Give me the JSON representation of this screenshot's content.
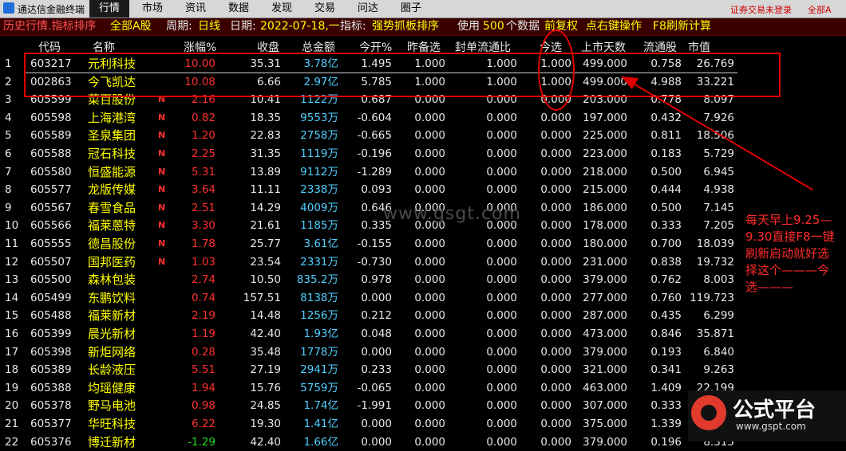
{
  "app": {
    "title": "通达信金融终端"
  },
  "menu": [
    {
      "label": "行情",
      "active": true
    },
    {
      "label": "市场",
      "active": false
    },
    {
      "label": "资讯",
      "active": false
    },
    {
      "label": "数据",
      "active": false
    },
    {
      "label": "发现",
      "active": false
    },
    {
      "label": "交易",
      "active": false
    },
    {
      "label": "问达",
      "active": false
    },
    {
      "label": "圈子",
      "active": false
    }
  ],
  "topright": {
    "login_status": "证券交易未登录",
    "account": "全部A"
  },
  "infobar": {
    "mode": "历史行情.指标排序",
    "board": "全部A股",
    "period_label": "周期:",
    "period": "日线",
    "date_label": "日期:",
    "date": "2022-07-18,一",
    "indicator_label": "指标:",
    "indicator": "强势抓板排序",
    "use_label": "使用",
    "count": "500",
    "count_suffix": "个数据",
    "adjust": "前复权",
    "right_click": "点右键操作",
    "refresh": "F8刷新计算"
  },
  "columns": [
    "代码",
    "名称",
    "涨幅%",
    "收盘",
    "总金额",
    "今开%",
    "昨备选",
    "封单流通比",
    "今选",
    "上市天数",
    "流通股",
    "市值"
  ],
  "rows": [
    {
      "idx": "1",
      "code": "603217",
      "name": "元利科技",
      "flag": "",
      "chg": "10.00",
      "chg_color": "red",
      "close": "35.31",
      "amount": "3.78亿",
      "open": "1.495",
      "open_color": "wht",
      "prev": "1.000",
      "seal": "1.000",
      "today": "1.000",
      "days": "499.000",
      "float": "0.758",
      "mcap": "26.769"
    },
    {
      "idx": "2",
      "code": "002863",
      "name": "今飞凯达",
      "flag": "",
      "chg": "10.08",
      "chg_color": "red",
      "close": "6.66",
      "amount": "2.97亿",
      "open": "5.785",
      "open_color": "wht",
      "prev": "1.000",
      "seal": "1.000",
      "today": "1.000",
      "days": "499.000",
      "float": "4.988",
      "mcap": "33.221"
    },
    {
      "idx": "3",
      "code": "605599",
      "name": "菜百股份",
      "flag": "N",
      "chg": "2.16",
      "chg_color": "red",
      "close": "10.41",
      "amount": "1122万",
      "open": "0.687",
      "open_color": "wht",
      "prev": "0.000",
      "seal": "0.000",
      "today": "0.000",
      "days": "203.000",
      "float": "0.778",
      "mcap": "8.097"
    },
    {
      "idx": "4",
      "code": "605598",
      "name": "上海港湾",
      "flag": "N",
      "chg": "0.82",
      "chg_color": "red",
      "close": "18.35",
      "amount": "9553万",
      "open": "-0.604",
      "open_color": "wht",
      "prev": "0.000",
      "seal": "0.000",
      "today": "0.000",
      "days": "197.000",
      "float": "0.432",
      "mcap": "7.926"
    },
    {
      "idx": "5",
      "code": "605589",
      "name": "圣泉集团",
      "flag": "N",
      "chg": "1.20",
      "chg_color": "red",
      "close": "22.83",
      "amount": "2758万",
      "open": "-0.665",
      "open_color": "wht",
      "prev": "0.000",
      "seal": "0.000",
      "today": "0.000",
      "days": "225.000",
      "float": "0.811",
      "mcap": "18.506"
    },
    {
      "idx": "6",
      "code": "605588",
      "name": "冠石科技",
      "flag": "N",
      "chg": "2.25",
      "chg_color": "red",
      "close": "31.35",
      "amount": "1119万",
      "open": "-0.196",
      "open_color": "wht",
      "prev": "0.000",
      "seal": "0.000",
      "today": "0.000",
      "days": "223.000",
      "float": "0.183",
      "mcap": "5.729"
    },
    {
      "idx": "7",
      "code": "605580",
      "name": "恒盛能源",
      "flag": "N",
      "chg": "5.31",
      "chg_color": "red",
      "close": "13.89",
      "amount": "9112万",
      "open": "-1.289",
      "open_color": "wht",
      "prev": "0.000",
      "seal": "0.000",
      "today": "0.000",
      "days": "218.000",
      "float": "0.500",
      "mcap": "6.945"
    },
    {
      "idx": "8",
      "code": "605577",
      "name": "龙版传媒",
      "flag": "N",
      "chg": "3.64",
      "chg_color": "red",
      "close": "11.11",
      "amount": "2338万",
      "open": "0.093",
      "open_color": "wht",
      "prev": "0.000",
      "seal": "0.000",
      "today": "0.000",
      "days": "215.000",
      "float": "0.444",
      "mcap": "4.938"
    },
    {
      "idx": "9",
      "code": "605567",
      "name": "春雪食品",
      "flag": "N",
      "chg": "2.51",
      "chg_color": "red",
      "close": "14.29",
      "amount": "4009万",
      "open": "0.646",
      "open_color": "wht",
      "prev": "0.000",
      "seal": "0.000",
      "today": "0.000",
      "days": "186.000",
      "float": "0.500",
      "mcap": "7.145"
    },
    {
      "idx": "10",
      "code": "605566",
      "name": "福莱蒽特",
      "flag": "N",
      "chg": "3.30",
      "chg_color": "red",
      "close": "21.61",
      "amount": "1185万",
      "open": "0.335",
      "open_color": "wht",
      "prev": "0.000",
      "seal": "0.000",
      "today": "0.000",
      "days": "178.000",
      "float": "0.333",
      "mcap": "7.205"
    },
    {
      "idx": "11",
      "code": "605555",
      "name": "德昌股份",
      "flag": "N",
      "chg": "1.78",
      "chg_color": "red",
      "close": "25.77",
      "amount": "3.61亿",
      "open": "-0.155",
      "open_color": "wht",
      "prev": "0.000",
      "seal": "0.000",
      "today": "0.000",
      "days": "180.000",
      "float": "0.700",
      "mcap": "18.039"
    },
    {
      "idx": "12",
      "code": "605507",
      "name": "国邦医药",
      "flag": "N",
      "chg": "1.03",
      "chg_color": "red",
      "close": "23.54",
      "amount": "2331万",
      "open": "-0.730",
      "open_color": "wht",
      "prev": "0.000",
      "seal": "0.000",
      "today": "0.000",
      "days": "231.000",
      "float": "0.838",
      "mcap": "19.732"
    },
    {
      "idx": "13",
      "code": "605500",
      "name": "森林包装",
      "flag": "",
      "chg": "2.74",
      "chg_color": "red",
      "close": "10.50",
      "amount": "835.2万",
      "open": "0.978",
      "open_color": "wht",
      "prev": "0.000",
      "seal": "0.000",
      "today": "0.000",
      "days": "379.000",
      "float": "0.762",
      "mcap": "8.003"
    },
    {
      "idx": "14",
      "code": "605499",
      "name": "东鹏饮料",
      "flag": "",
      "chg": "0.74",
      "chg_color": "red",
      "close": "157.51",
      "amount": "8138万",
      "open": "0.000",
      "open_color": "wht",
      "prev": "0.000",
      "seal": "0.000",
      "today": "0.000",
      "days": "277.000",
      "float": "0.760",
      "mcap": "119.723"
    },
    {
      "idx": "15",
      "code": "605488",
      "name": "福莱新材",
      "flag": "",
      "chg": "2.19",
      "chg_color": "red",
      "close": "14.48",
      "amount": "1256万",
      "open": "0.212",
      "open_color": "wht",
      "prev": "0.000",
      "seal": "0.000",
      "today": "0.000",
      "days": "287.000",
      "float": "0.435",
      "mcap": "6.299"
    },
    {
      "idx": "16",
      "code": "605399",
      "name": "晨光新材",
      "flag": "",
      "chg": "1.19",
      "chg_color": "red",
      "close": "42.40",
      "amount": "1.93亿",
      "open": "0.048",
      "open_color": "wht",
      "prev": "0.000",
      "seal": "0.000",
      "today": "0.000",
      "days": "473.000",
      "float": "0.846",
      "mcap": "35.871"
    },
    {
      "idx": "17",
      "code": "605398",
      "name": "新炬网络",
      "flag": "",
      "chg": "0.28",
      "chg_color": "red",
      "close": "35.48",
      "amount": "1778万",
      "open": "0.000",
      "open_color": "wht",
      "prev": "0.000",
      "seal": "0.000",
      "today": "0.000",
      "days": "379.000",
      "float": "0.193",
      "mcap": "6.840"
    },
    {
      "idx": "18",
      "code": "605389",
      "name": "长龄液压",
      "flag": "",
      "chg": "5.51",
      "chg_color": "red",
      "close": "27.19",
      "amount": "2941万",
      "open": "0.233",
      "open_color": "wht",
      "prev": "0.000",
      "seal": "0.000",
      "today": "0.000",
      "days": "321.000",
      "float": "0.341",
      "mcap": "9.263"
    },
    {
      "idx": "19",
      "code": "605388",
      "name": "均瑶健康",
      "flag": "",
      "chg": "1.94",
      "chg_color": "red",
      "close": "15.76",
      "amount": "5759万",
      "open": "-0.065",
      "open_color": "wht",
      "prev": "0.000",
      "seal": "0.000",
      "today": "0.000",
      "days": "463.000",
      "float": "1.409",
      "mcap": "22.199"
    },
    {
      "idx": "20",
      "code": "605378",
      "name": "野马电池",
      "flag": "",
      "chg": "0.98",
      "chg_color": "red",
      "close": "24.85",
      "amount": "1.74亿",
      "open": "-1.991",
      "open_color": "wht",
      "prev": "0.000",
      "seal": "0.000",
      "today": "0.000",
      "days": "307.000",
      "float": "0.333",
      "mcap": "8.290"
    },
    {
      "idx": "21",
      "code": "605377",
      "name": "华旺科技",
      "flag": "",
      "chg": "6.22",
      "chg_color": "red",
      "close": "19.30",
      "amount": "1.41亿",
      "open": "0.000",
      "open_color": "wht",
      "prev": "0.000",
      "seal": "0.000",
      "today": "0.000",
      "days": "375.000",
      "float": "1.339",
      "mcap": "25.841"
    },
    {
      "idx": "22",
      "code": "605376",
      "name": "博迁新材",
      "flag": "",
      "chg": "-1.29",
      "chg_color": "green",
      "close": "42.40",
      "amount": "1.66亿",
      "open": "0.000",
      "open_color": "wht",
      "prev": "0.000",
      "seal": "0.000",
      "today": "0.000",
      "days": "379.000",
      "float": "0.196",
      "mcap": "8.315"
    }
  ],
  "watermark": "www.gsgt.com",
  "annotation": "每天早上9.25—9.30直接F8一键刷新启动就好选择这个———今选———",
  "brand": {
    "name": "公式平台",
    "url": "www.gspt.com"
  },
  "colors": {
    "up": "#ff3030",
    "down": "#22dd22",
    "name": "#ffff00",
    "amount": "#4fd0ff",
    "annotation": "#e00000"
  }
}
